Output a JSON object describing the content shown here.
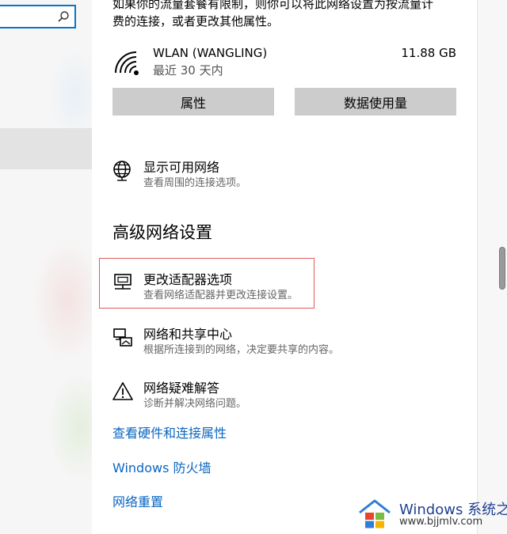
{
  "search": {
    "placeholder": ""
  },
  "intro": {
    "text": "如果你的流量套餐有限制，则你可以将此网络设置为按流量计\n费的连接，或者更改其他属性。"
  },
  "usage": {
    "network_name": "WLAN (WANGLING)",
    "period": "最近 30 天内",
    "size": "11.88 GB"
  },
  "buttons": {
    "properties": "属性",
    "data_usage": "数据使用量"
  },
  "show_networks": {
    "title": "显示可用网络",
    "subtitle": "查看周围的连接选项。"
  },
  "advanced": {
    "heading": "高级网络设置"
  },
  "items": [
    {
      "title": "更改适配器选项",
      "subtitle": "查看网络适配器并更改连接设置。"
    },
    {
      "title": "网络和共享中心",
      "subtitle": "根据所连接到的网络，决定要共享的内容。"
    },
    {
      "title": "网络疑难解答",
      "subtitle": "诊断并解决网络问题。"
    }
  ],
  "links": {
    "hardware": "查看硬件和连接属性",
    "firewall": "Windows 防火墙",
    "reset": "网络重置"
  },
  "watermark": {
    "brand": "Windows 系统之家",
    "url": "www.bjjmlv.com"
  },
  "colors": {
    "accent": "#0a66c2",
    "highlight_border": "#e05a5a",
    "button_bg": "#cccccc"
  }
}
